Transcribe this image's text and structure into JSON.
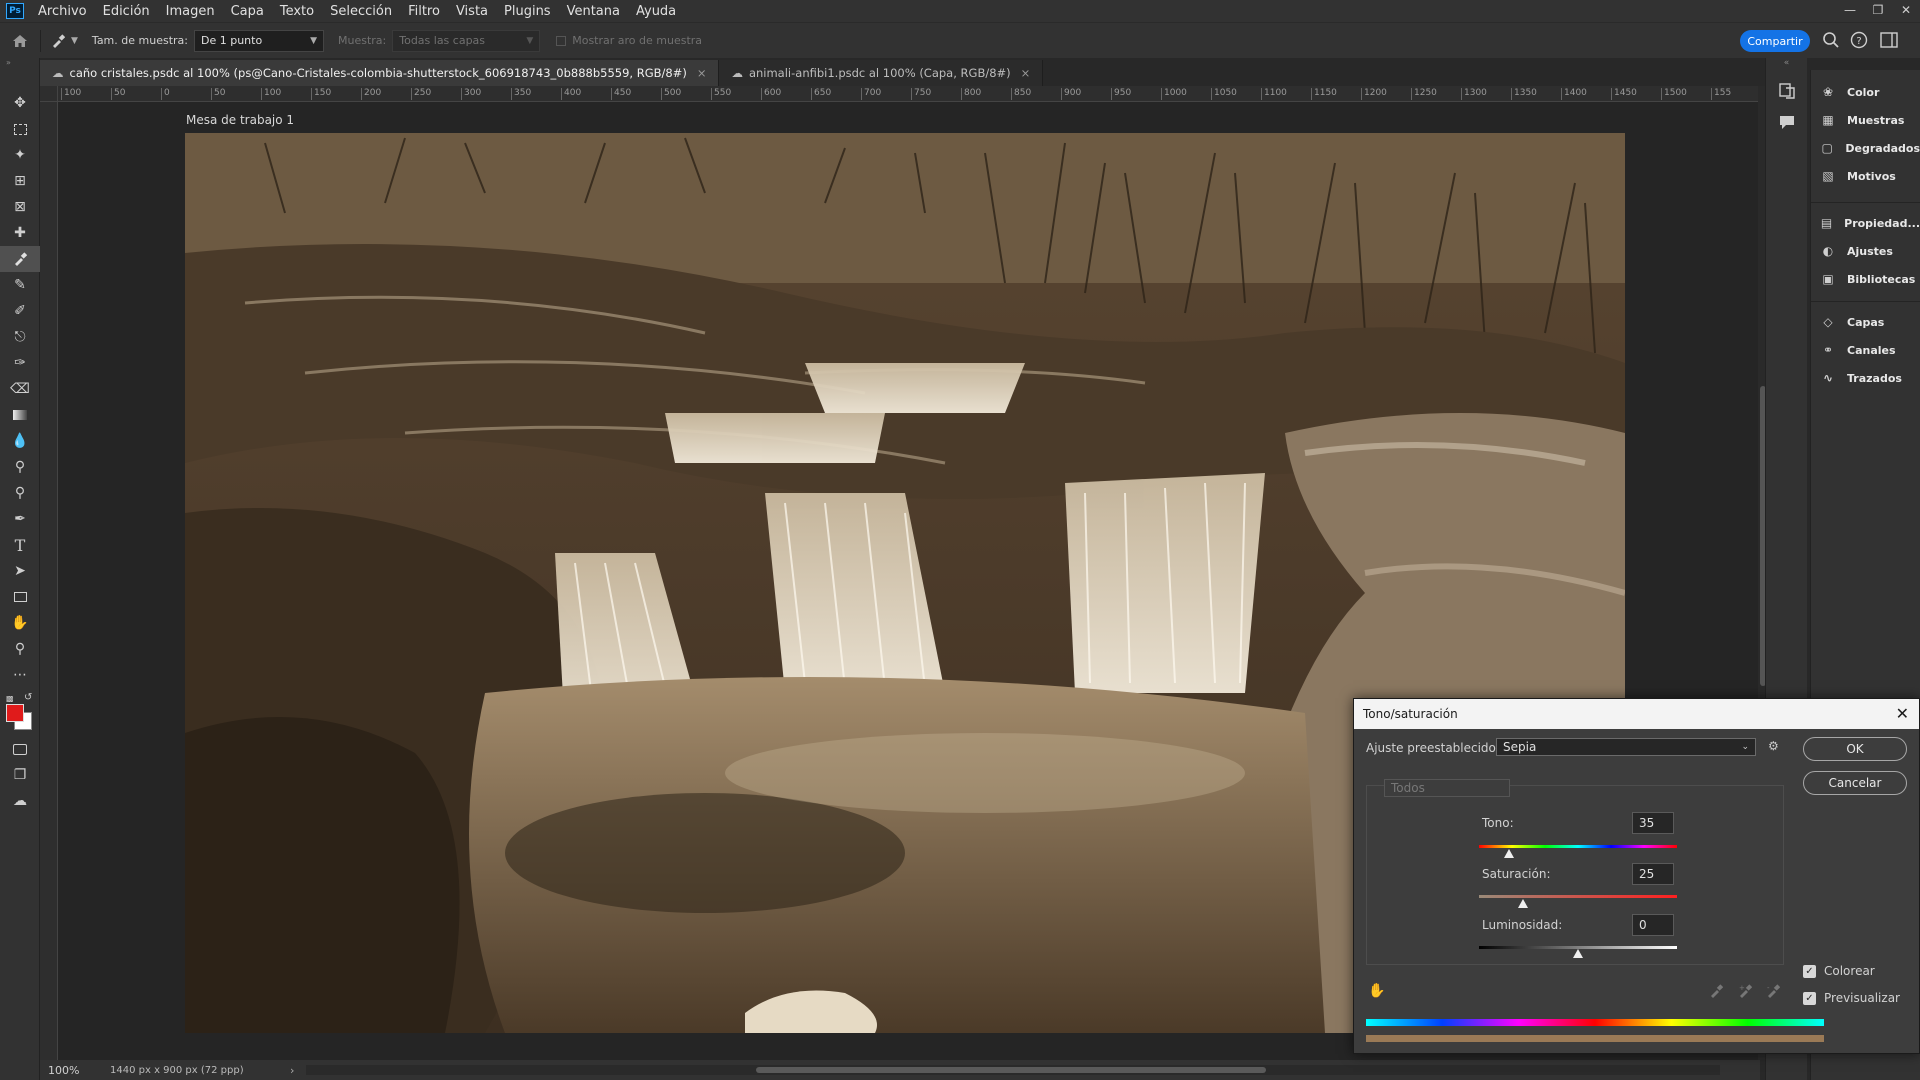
{
  "app": {
    "logo": "Ps"
  },
  "menu": [
    "Archivo",
    "Edición",
    "Imagen",
    "Capa",
    "Texto",
    "Selección",
    "Filtro",
    "Vista",
    "Plugins",
    "Ventana",
    "Ayuda"
  ],
  "options": {
    "sample_size_label": "Tam. de muestra:",
    "sample_size_value": "De 1 punto",
    "sample_label": "Muestra:",
    "sample_value": "Todas las capas",
    "show_ring_label": "Mostrar aro de muestra",
    "share_label": "Compartir"
  },
  "tabs": [
    {
      "title": "caño cristales.psdc al 100% (ps@Cano-Cristales-colombia-shutterstock_606918743_0b888b5559, RGB/8#)",
      "active": true
    },
    {
      "title": "animali-anfibi1.psdc al 100% (Capa, RGB/8#)",
      "active": false
    }
  ],
  "ruler_ticks": [
    "100",
    "50",
    "0",
    "50",
    "100",
    "150",
    "200",
    "250",
    "300",
    "350",
    "400",
    "450",
    "500",
    "550",
    "600",
    "650",
    "700",
    "750",
    "800",
    "850",
    "900",
    "950",
    "1000",
    "1050",
    "1100",
    "1150",
    "1200",
    "1250",
    "1300",
    "1350",
    "1400",
    "1450",
    "1500",
    "155"
  ],
  "canvas": {
    "artboard_label": "Mesa de trabajo 1"
  },
  "status": {
    "zoom": "100%",
    "doc_info": "1440 px x 900 px (72 ppp)"
  },
  "panels": {
    "group1": [
      {
        "label": "Color",
        "icon": "color-wheel-icon"
      },
      {
        "label": "Muestras",
        "icon": "swatches-grid-icon"
      },
      {
        "label": "Degradados",
        "icon": "gradient-icon"
      },
      {
        "label": "Motivos",
        "icon": "pattern-icon"
      }
    ],
    "group2": [
      {
        "label": "Propiedad...",
        "icon": "properties-icon"
      },
      {
        "label": "Ajustes",
        "icon": "adjustments-icon"
      },
      {
        "label": "Bibliotecas",
        "icon": "libraries-icon"
      }
    ],
    "group3": [
      {
        "label": "Capas",
        "icon": "layers-icon"
      },
      {
        "label": "Canales",
        "icon": "channels-icon"
      },
      {
        "label": "Trazados",
        "icon": "paths-icon"
      }
    ]
  },
  "dialog": {
    "title": "Tono/saturación",
    "preset_label": "Ajuste preestablecido:",
    "preset_value": "Sepia",
    "channel_value": "Todos",
    "hue_label": "Tono:",
    "hue_value": "35",
    "hue_slider": 35,
    "saturation_label": "Saturación:",
    "saturation_value": "25",
    "saturation_slider": 25,
    "lightness_label": "Luminosidad:",
    "lightness_value": "0",
    "ok_label": "OK",
    "cancel_label": "Cancelar",
    "colorize_label": "Colorear",
    "colorize_checked": true,
    "preview_label": "Previsualizar",
    "preview_checked": true,
    "colorize_color": "#9a7a56"
  },
  "colors": {
    "accent": "#1473e6",
    "foreground": "#e01b1b",
    "background": "#ffffff"
  }
}
